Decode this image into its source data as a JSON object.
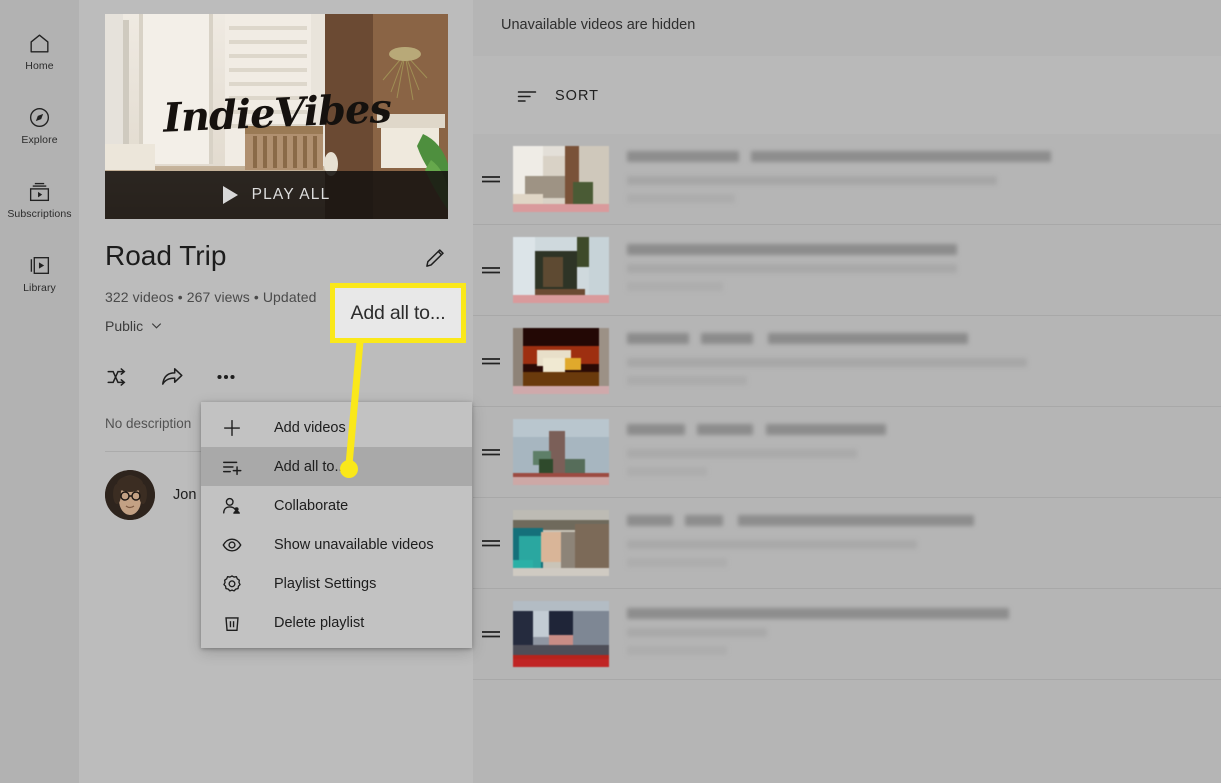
{
  "nav": {
    "items": [
      {
        "label": "Home",
        "icon": "home-icon"
      },
      {
        "label": "Explore",
        "icon": "compass-icon"
      },
      {
        "label": "Subscriptions",
        "icon": "subscriptions-icon"
      },
      {
        "label": "Library",
        "icon": "library-icon"
      }
    ]
  },
  "playlist": {
    "thumbnail_logo": "IndieVibes",
    "play_all_label": "PLAY ALL",
    "title": "Road Trip",
    "edit_icon": "pencil-icon",
    "meta": "322 videos • 267 views • Updated",
    "video_count": "322 videos",
    "view_count": "267 views",
    "updated_text": "Updated",
    "privacy": "Public",
    "privacy_chevron": "chevron-down-icon",
    "description": "No description",
    "owner_name": "Jon",
    "actions": [
      {
        "name": "shuffle-button",
        "icon": "shuffle-icon"
      },
      {
        "name": "share-button",
        "icon": "share-arrow-icon"
      },
      {
        "name": "more-options-button",
        "icon": "three-dots-icon"
      }
    ]
  },
  "menu": {
    "items": [
      {
        "label": "Add videos",
        "icon": "plus-icon",
        "active": false
      },
      {
        "label": "Add all to...",
        "icon": "playlist-add-icon",
        "active": true
      },
      {
        "label": "Collaborate",
        "icon": "person-add-icon",
        "active": false
      },
      {
        "label": "Show unavailable videos",
        "icon": "eye-icon",
        "active": false
      },
      {
        "label": "Playlist Settings",
        "icon": "gear-icon",
        "active": false
      },
      {
        "label": "Delete playlist",
        "icon": "trash-icon",
        "active": false
      }
    ]
  },
  "callout": {
    "text": "Add all to...",
    "border_color": "#fae81a",
    "fill_color": "#e8e8e8"
  },
  "video_pane": {
    "unavailable_note": "Unavailable videos are hidden",
    "sort_label": "SORT",
    "sort_icon": "sort-icon",
    "rows": [
      {
        "handle": "drag-handle-icon",
        "thumb_tone": "pale-window",
        "progress_color": "#d99a9c",
        "title_w": [
          112,
          300
        ],
        "sub_w": [
          120,
          98,
          270,
          92
        ],
        "extra_w": [
          108
        ]
      },
      {
        "handle": "drag-handle-icon",
        "thumb_tone": "dark-foliage",
        "progress_color": "#d99a9c",
        "title_w": [
          330
        ],
        "sub_w": [
          100,
          86,
          180,
          90
        ],
        "extra_w": [
          96
        ]
      },
      {
        "handle": "drag-handle-icon",
        "thumb_tone": "fire-orange",
        "progress_color": "#cfa9ab",
        "title_w": [
          62,
          52,
          200,
          130
        ],
        "sub_w": [
          88,
          300
        ],
        "extra_w": [
          120,
          60
        ]
      },
      {
        "handle": "drag-handle-icon",
        "thumb_tone": "blue-gray",
        "progress_color": "#cda8a6",
        "title_w": [
          58,
          56,
          120,
          72
        ],
        "sub_w": [
          78,
          126,
          60
        ],
        "extra_w": [
          80
        ]
      },
      {
        "handle": "drag-handle-icon",
        "thumb_tone": "teal-sand",
        "progress_color": "#cfcac2",
        "title_w": [
          46,
          38,
          236
        ],
        "sub_w": [
          96,
          90,
          74
        ],
        "extra_w": [
          100
        ]
      },
      {
        "handle": "drag-handle-icon",
        "thumb_tone": "navy-rose",
        "progress_color": "#c02525",
        "title_w": [
          382
        ],
        "sub_w": [
          72,
          64
        ],
        "extra_w": [
          100
        ]
      }
    ]
  },
  "colors": {
    "rail_bg": "#b2b2b2",
    "panel_bg": "#bcbcbc",
    "pane_bg": "#b5b5b5",
    "menu_bg": "#c2c2c2",
    "menu_active": "#a9a9a9",
    "accent_yellow": "#fae81a"
  }
}
